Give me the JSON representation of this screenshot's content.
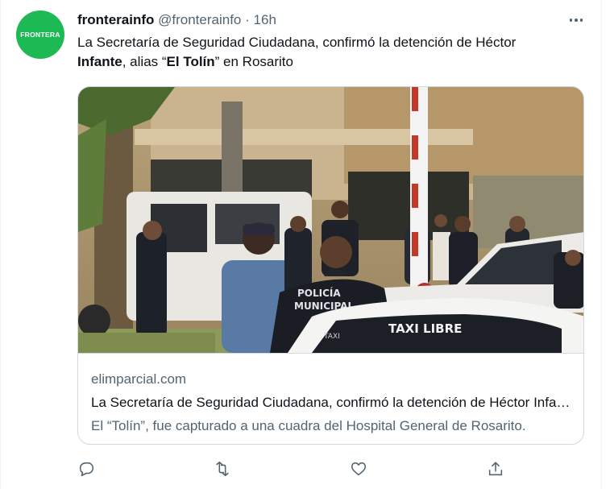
{
  "avatar": {
    "text": "FRONTERA",
    "color": "#1db954"
  },
  "header": {
    "name": "fronterainfo",
    "handle": "@fronterainfo",
    "separator": "·",
    "time": "16h"
  },
  "tweet": {
    "line1": "La Secretaría de Seguridad Ciudadana, confirmó la detención de Héctor",
    "bold1": "Infante",
    "part2": ", alias “",
    "bold2": "El Tolín",
    "part3": "” en Rosarito"
  },
  "card": {
    "image_texts": {
      "vest": "POLICÍA MUNICIPAL",
      "taxi": "TAXI LIBRE",
      "taxi_small": "TAXI"
    },
    "domain": "elimparcial.com",
    "title": "La Secretaría de Seguridad Ciudadana, confirmó la detención de Héctor Infante, alias “El Tolín” en Rosarito",
    "description": "El “Tolín”, fue capturado a una cuadra del Hospital General de Rosarito."
  },
  "actions": [
    {
      "icon": "reply-icon"
    },
    {
      "icon": "retweet-icon"
    },
    {
      "icon": "like-icon"
    },
    {
      "icon": "share-icon"
    }
  ],
  "colors": {
    "text": "#0f1419",
    "secondary": "#536471",
    "border": "#cfd9de"
  }
}
